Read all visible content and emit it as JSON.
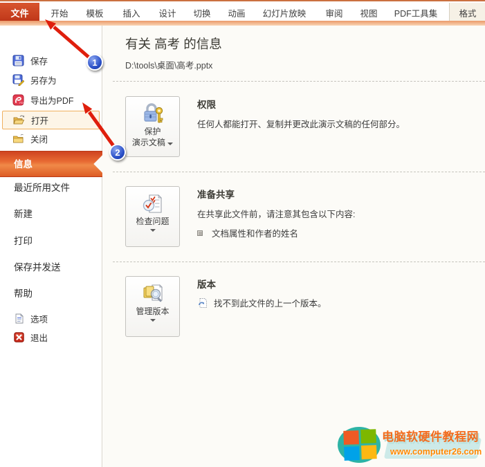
{
  "window": {
    "tabs": [
      {
        "label": "文件",
        "active": true
      },
      {
        "label": "开始"
      },
      {
        "label": "模板"
      },
      {
        "label": "插入"
      },
      {
        "label": "设计"
      },
      {
        "label": "切换"
      },
      {
        "label": "动画"
      },
      {
        "label": "幻灯片放映"
      },
      {
        "label": "审阅"
      },
      {
        "label": "视图"
      },
      {
        "label": "PDF工具集"
      },
      {
        "label": "格式",
        "contextual": true
      }
    ]
  },
  "sidebar": {
    "commands": [
      {
        "label": "保存",
        "icon": "floppy-disk"
      },
      {
        "label": "另存为",
        "icon": "floppy-disk-pencil"
      },
      {
        "label": "导出为PDF",
        "icon": "pdf-export"
      },
      {
        "label": "打开",
        "icon": "open-folder",
        "highlighted": true
      },
      {
        "label": "关闭",
        "icon": "folder"
      }
    ],
    "nav": [
      {
        "label": "信息",
        "selected": true
      },
      {
        "label": "最近所用文件"
      },
      {
        "label": "新建"
      },
      {
        "label": "打印"
      },
      {
        "label": "保存并发送"
      },
      {
        "label": "帮助"
      }
    ],
    "footer": [
      {
        "label": "选项",
        "icon": "options-page"
      },
      {
        "label": "退出",
        "icon": "exit-x"
      }
    ]
  },
  "main": {
    "title": "有关 高考 的信息",
    "file_path": "D:\\tools\\桌面\\高考.pptx",
    "sections": [
      {
        "button_line1": "保护",
        "button_line2": "演示文稿",
        "button_icon": "lock-and-key",
        "heading": "权限",
        "body": "任何人都能打开、复制并更改此演示文稿的任何部分。"
      },
      {
        "button_label": "检查问题",
        "button_icon": "inspect-document",
        "heading": "准备共享",
        "body": "在共享此文件前，请注意其包含以下内容:",
        "bullet": "文档属性和作者的姓名"
      },
      {
        "button_label": "管理版本",
        "button_icon": "manage-versions",
        "heading": "版本",
        "item": "找不到此文件的上一个版本。",
        "item_icon": "previous-version-page"
      }
    ]
  },
  "annotations": {
    "badge1": "1",
    "badge2": "2"
  },
  "watermark": {
    "site_name": "电脑软硬件教程网",
    "site_url": "www.computer26.com"
  },
  "colors": {
    "accent_orange": "#cf4323",
    "selected_nav": "#e86a33",
    "hover_border": "#f0b05f",
    "arrow_red": "#df1f0d",
    "badge_blue": "#2a50c8",
    "watermark_teal": "#2eb3a5",
    "watermark_orange": "#f26c1e",
    "url_orange": "#ff8800"
  }
}
